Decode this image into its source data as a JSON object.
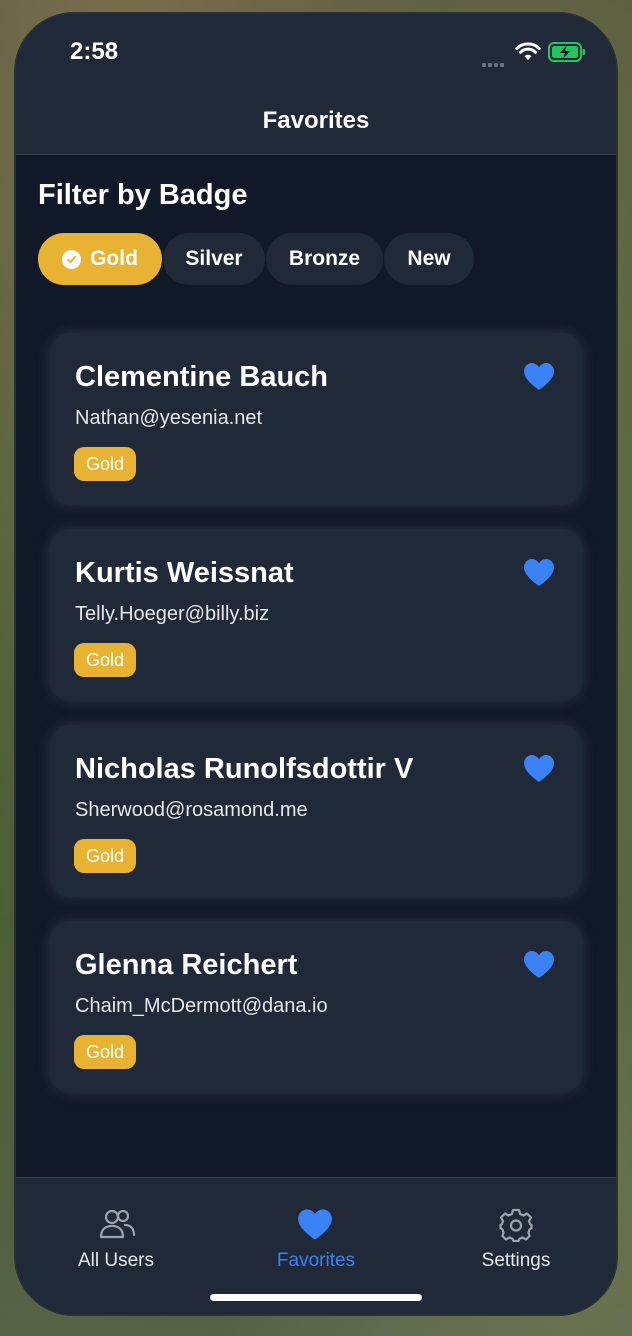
{
  "status": {
    "time": "2:58"
  },
  "nav": {
    "title": "Favorites"
  },
  "filter": {
    "heading": "Filter by Badge",
    "chips": [
      {
        "label": "Gold",
        "selected": true
      },
      {
        "label": "Silver",
        "selected": false
      },
      {
        "label": "Bronze",
        "selected": false
      },
      {
        "label": "New",
        "selected": false
      }
    ]
  },
  "users": [
    {
      "name": "Clementine Bauch",
      "email": "Nathan@yesenia.net",
      "badge": "Gold"
    },
    {
      "name": "Kurtis Weissnat",
      "email": "Telly.Hoeger@billy.biz",
      "badge": "Gold"
    },
    {
      "name": "Nicholas Runolfsdottir V",
      "email": "Sherwood@rosamond.me",
      "badge": "Gold"
    },
    {
      "name": "Glenna Reichert",
      "email": "Chaim_McDermott@dana.io",
      "badge": "Gold"
    }
  ],
  "tabs": [
    {
      "label": "All Users",
      "icon": "users-icon",
      "active": false
    },
    {
      "label": "Favorites",
      "icon": "heart-icon",
      "active": true
    },
    {
      "label": "Settings",
      "icon": "gear-icon",
      "active": false
    }
  ],
  "colors": {
    "accent_gold": "#e8b332",
    "accent_blue": "#3b82f6",
    "background": "#111827",
    "surface": "#1f2937"
  }
}
